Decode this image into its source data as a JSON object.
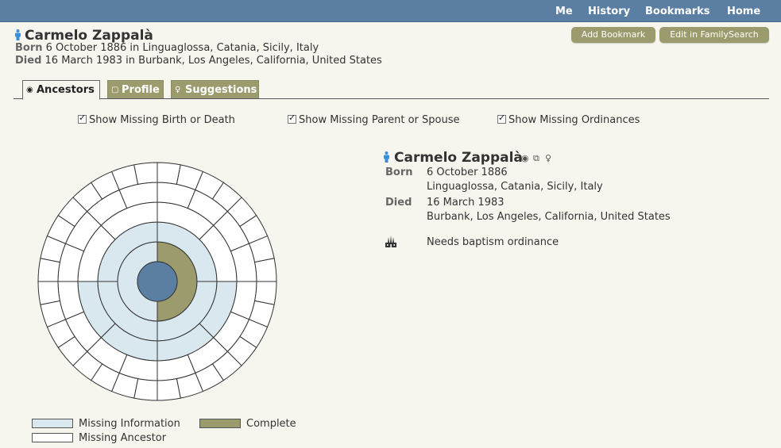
{
  "nav": {
    "me": "Me",
    "history": "History",
    "bookmarks": "Bookmarks",
    "home": "Home"
  },
  "header": {
    "name": "Carmelo Zappalà",
    "born_label": "Born",
    "born_text": "6 October 1886 in Linguaglossa, Catania, Sicily, Italy",
    "died_label": "Died",
    "died_text": "16 March 1983 in Burbank, Los Angeles, California, United States"
  },
  "buttons": {
    "add_bookmark": "Add Bookmark",
    "edit_familysearch": "Edit in FamilySearch"
  },
  "tabs": [
    {
      "label": "Ancestors",
      "active": true,
      "icon": "radio-icon"
    },
    {
      "label": "Profile",
      "active": false,
      "icon": "document-icon"
    },
    {
      "label": "Suggestions",
      "active": false,
      "icon": "lightbulb-icon"
    }
  ],
  "options": [
    {
      "label": "Show Missing Birth or Death",
      "checked": true
    },
    {
      "label": "Show Missing Parent or Spouse",
      "checked": true
    },
    {
      "label": "Show Missing Ordinances",
      "checked": true
    }
  ],
  "details": {
    "name": "Carmelo Zappalà",
    "born_label": "Born",
    "born_date": "6 October 1886",
    "born_place": "Linguaglossa, Catania, Sicily, Italy",
    "died_label": "Died",
    "died_date": "16 March 1983",
    "died_place": "Burbank, Los Angeles, California, United States",
    "ordinance": "Needs baptism ordinance",
    "icons": [
      "ancestors-view-icon",
      "profile-icon",
      "suggestions-icon",
      "temple-icon"
    ]
  },
  "legend": {
    "missing_info": "Missing Information",
    "complete": "Complete",
    "missing_ancestor": "Missing Ancestor"
  },
  "colors": {
    "nav_bar": "#5b7fa3",
    "root": "#5b7fa3",
    "complete": "#9b9b6d",
    "missing_info": "#d9e8ef",
    "missing_ancestor": "#ffffff",
    "person_icon": "#3a8de0"
  },
  "fan_chart": {
    "root": "root",
    "generations": [
      [
        "complete",
        "missing_info"
      ],
      [
        "missing_info",
        "missing_info",
        "missing_info",
        "missing_info"
      ],
      [
        "missing_ancestor",
        "missing_ancestor",
        "missing_info",
        "missing_info",
        "missing_info",
        "missing_info",
        "missing_ancestor",
        "missing_ancestor"
      ],
      [
        "missing_ancestor",
        "missing_ancestor",
        "missing_ancestor",
        "missing_ancestor",
        "missing_ancestor",
        "missing_ancestor",
        "missing_ancestor",
        "missing_ancestor",
        "missing_ancestor",
        "missing_ancestor",
        "missing_ancestor",
        "missing_ancestor",
        "missing_ancestor",
        "missing_ancestor",
        "missing_ancestor",
        "missing_ancestor"
      ],
      [
        "missing_ancestor",
        "missing_ancestor",
        "missing_ancestor",
        "missing_ancestor",
        "missing_ancestor",
        "missing_ancestor",
        "missing_ancestor",
        "missing_ancestor",
        "missing_ancestor",
        "missing_ancestor",
        "missing_ancestor",
        "missing_ancestor",
        "missing_ancestor",
        "missing_ancestor",
        "missing_ancestor",
        "missing_ancestor",
        "missing_ancestor",
        "missing_ancestor",
        "missing_ancestor",
        "missing_ancestor",
        "missing_ancestor",
        "missing_ancestor",
        "missing_ancestor",
        "missing_ancestor",
        "missing_ancestor",
        "missing_ancestor",
        "missing_ancestor",
        "missing_ancestor",
        "missing_ancestor",
        "missing_ancestor",
        "missing_ancestor",
        "missing_ancestor"
      ]
    ]
  }
}
